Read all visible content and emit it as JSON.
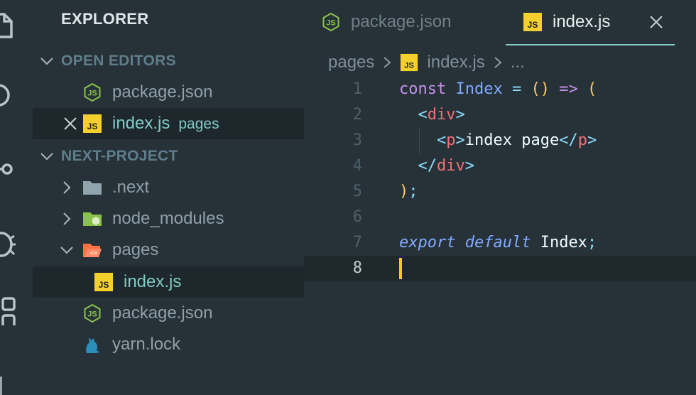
{
  "sidebar": {
    "title": "EXPLORER",
    "sections": {
      "open_editors": "OPEN EDITORS",
      "project": "NEXT-PROJECT"
    },
    "open_editors": [
      {
        "name": "package.json",
        "icon": "nodejs-icon"
      },
      {
        "name": "index.js",
        "description": "pages",
        "icon": "js-file-icon",
        "has_close": true
      }
    ],
    "tree": [
      {
        "name": ".next",
        "icon": "folder-icon"
      },
      {
        "name": "node_modules",
        "icon": "node-folder-icon"
      },
      {
        "name": "pages",
        "icon": "folder-open-icon"
      },
      {
        "name": "index.js",
        "icon": "js-file-icon"
      },
      {
        "name": "package.json",
        "icon": "nodejs-icon"
      },
      {
        "name": "yarn.lock",
        "icon": "yarn-cat-icon"
      }
    ]
  },
  "tabs": [
    {
      "label": "package.json",
      "active": false,
      "icon": "nodejs-icon"
    },
    {
      "label": "index.js",
      "active": true,
      "icon": "js-file-icon"
    }
  ],
  "breadcrumb": {
    "folder": "pages",
    "file": "index.js",
    "more": "..."
  },
  "code": {
    "line_numbers": [
      "1",
      "2",
      "3",
      "4",
      "5",
      "6",
      "7",
      "8"
    ],
    "current_line": "8",
    "l1": {
      "kw": "const",
      "name": "Index",
      "eq": "=",
      "p": "()",
      "arrow": "=>",
      "open": "("
    },
    "l2": {
      "lt": "<",
      "tag": "div",
      "gt": ">"
    },
    "l3": {
      "lt": "<",
      "tag": "p",
      "gt": ">",
      "text": "index page",
      "lt2": "</",
      "tag2": "p",
      "gt2": ">"
    },
    "l4": {
      "lt": "</",
      "tag": "div",
      "gt": ">"
    },
    "l5": {
      "close": ")",
      "semi": ";"
    },
    "l7": {
      "kw1": "export",
      "kw2": "default",
      "name": "Index",
      "semi": ";"
    }
  },
  "colors": {
    "background": "#263238",
    "accent": "#80cbc4",
    "caret": "#ffcc00",
    "js_badge": "#f5cf2c",
    "node_green": "#8bc34a"
  }
}
